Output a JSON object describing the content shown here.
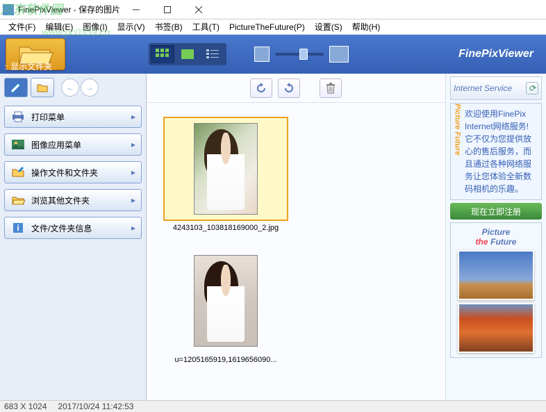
{
  "window": {
    "title": "FinePixViewer - 保存的图片"
  },
  "watermark": {
    "main": "河东软件园",
    "sub": "www.pc0359.cn"
  },
  "menu": {
    "file": "文件(F)",
    "edit": "编辑(E)",
    "image": "图像(I)",
    "view": "显示(V)",
    "bookmark": "书签(B)",
    "tools": "工具(T)",
    "ptf": "PictureTheFuture(P)",
    "settings": "设置(S)",
    "help": "帮助(H)"
  },
  "toolbar": {
    "panel_label": "显示文件夹",
    "brand": "FinePixViewer"
  },
  "sidebar": {
    "buttons": [
      {
        "label": "打印菜单"
      },
      {
        "label": "图像应用菜单"
      },
      {
        "label": "操作文件和文件夹"
      },
      {
        "label": "浏览其他文件夹"
      },
      {
        "label": "文件/文件夹信息"
      }
    ]
  },
  "thumbs": [
    {
      "name": "4243103_103818169000_2.jpg",
      "selected": true
    },
    {
      "name": "u=1205165919,1619656090..."
    }
  ],
  "rightpanel": {
    "service_title": "Internet Service",
    "promo_text": "欢迎使用FinePix Internet网络服务!它不仅为您提供放心的售后服务，而且通过各种网络服务让您体验全新数码相机的乐趣。",
    "ptf_vertical": "Picture Future",
    "register": "现在立即注册",
    "ptf_line1": "Picture",
    "ptf_the": "the",
    "ptf_line2": "Future"
  },
  "status": {
    "dimensions": "683 X 1024",
    "datetime": "2017/10/24 11:42:53"
  }
}
